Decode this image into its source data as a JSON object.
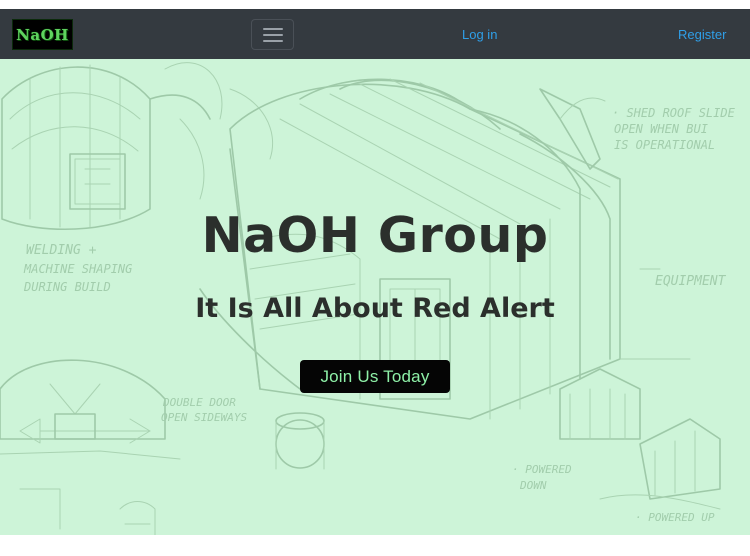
{
  "navbar": {
    "brand": "NaOH",
    "toggler_icon": "hamburger-icon",
    "links": [
      {
        "label": "Log in"
      },
      {
        "label": "Register"
      }
    ],
    "colors": {
      "background": "#343a40",
      "link": "#2f9fe8",
      "brand_text": "#5fd35f"
    }
  },
  "hero": {
    "title": "NaOH Group",
    "subtitle": "It Is All About Red Alert",
    "cta_label": "Join Us Today",
    "background_image": "hand-drawn-factory-sketch",
    "colors": {
      "background": "#cdf4d8",
      "cta_background": "#050505",
      "cta_text": "#8ef0a7",
      "text": "#2b2f2c"
    },
    "sketch_notes": [
      "SHED ROOF SLIDE",
      "OPEN WHEN BUI",
      "IS OPERATIONAL",
      "WELDING +",
      "MACHINE SHAPING",
      "DURING BUILD",
      "EQUIPMENT",
      "DOUBLE DOOR",
      "OPEN SIDEWAYS",
      "POWERED",
      "DOWN",
      "POWERED UP"
    ]
  }
}
